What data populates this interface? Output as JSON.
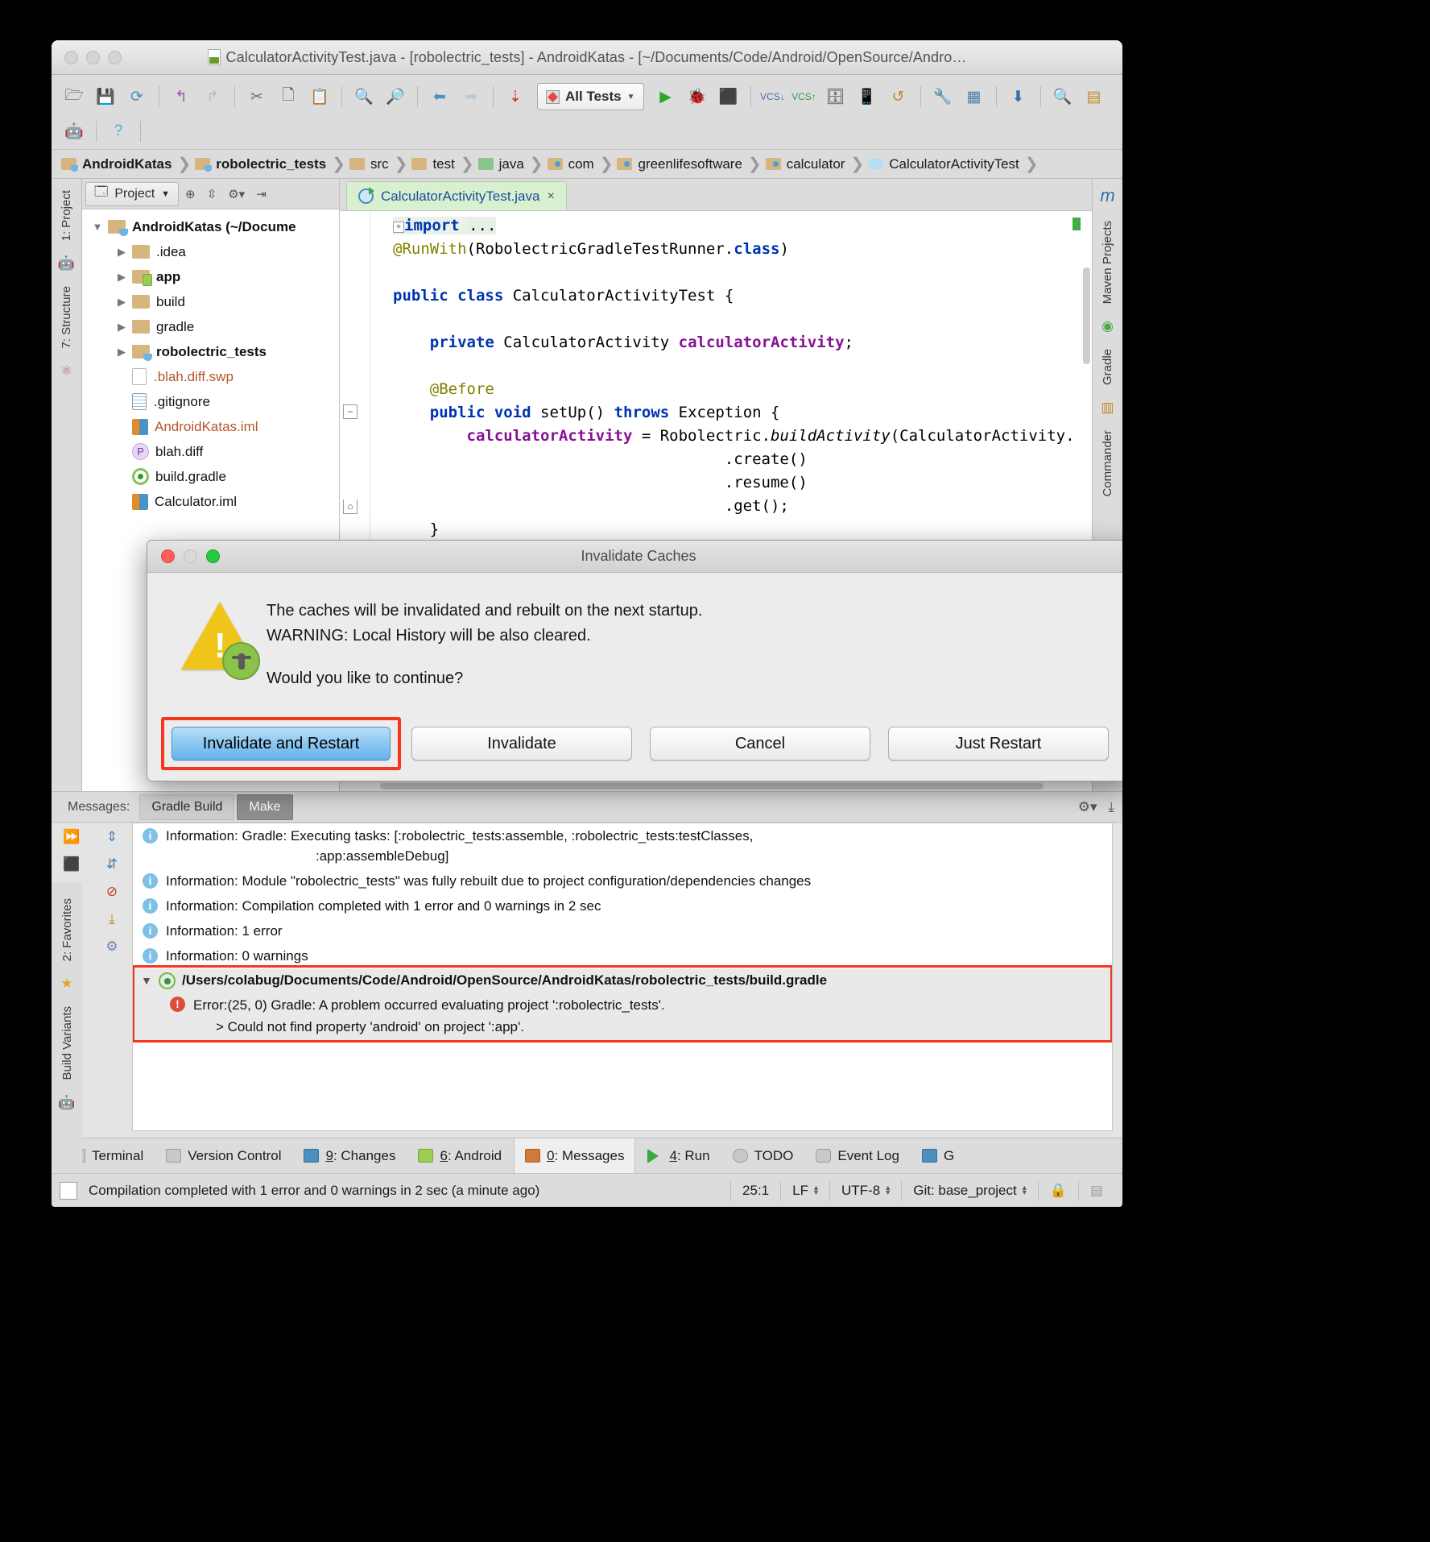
{
  "window": {
    "title": "CalculatorActivityTest.java - [robolectric_tests] - AndroidKatas - [~/Documents/Code/Android/OpenSource/Andro…",
    "title_icon": "java-file-icon"
  },
  "toolbar": {
    "run_config": "All Tests",
    "icons": [
      "open-folder-icon",
      "save-icon",
      "sync-icon",
      "undo-icon",
      "redo-icon",
      "cut-icon",
      "copy-icon",
      "paste-icon",
      "find-icon",
      "replace-icon",
      "back-icon",
      "forward-icon",
      "sort-icon",
      "run-icon",
      "debug-icon",
      "attach-debugger-icon",
      "vcs-update-icon",
      "vcs-commit-icon",
      "sdk-manager-icon",
      "avd-manager-icon",
      "rerun-icon",
      "search-everywhere-icon",
      "project-structure-icon",
      "download-icon",
      "inspect-icon",
      "android-icon",
      "help-icon"
    ]
  },
  "breadcrumbs": [
    {
      "label": "AndroidKatas",
      "icon": "folder-module-icon",
      "bold": true,
      "style": "cup"
    },
    {
      "label": "robolectric_tests",
      "icon": "folder-module-icon",
      "bold": true,
      "style": "cup"
    },
    {
      "label": "src",
      "icon": "folder-icon",
      "bold": false,
      "style": "plain"
    },
    {
      "label": "test",
      "icon": "folder-icon",
      "bold": false,
      "style": "plain"
    },
    {
      "label": "java",
      "icon": "folder-source-icon",
      "bold": false,
      "style": "green"
    },
    {
      "label": "com",
      "icon": "folder-package-icon",
      "bold": false,
      "style": "dot"
    },
    {
      "label": "greenlifesoftware",
      "icon": "folder-package-icon",
      "bold": false,
      "style": "dot"
    },
    {
      "label": "calculator",
      "icon": "folder-package-icon",
      "bold": false,
      "style": "dot"
    },
    {
      "label": "CalculatorActivityTest",
      "icon": "class-icon",
      "bold": false,
      "style": "class"
    }
  ],
  "left_rail": {
    "items": [
      "1: Project",
      "7: Structure"
    ],
    "bottom_items": [
      "2: Favorites",
      "Build Variants"
    ]
  },
  "right_rail": {
    "items": [
      "Maven Projects",
      "Gradle",
      "Commander"
    ],
    "logo": "m"
  },
  "project_panel": {
    "tab_label": "Project",
    "header_icons": [
      "target-icon",
      "collapse-all-icon",
      "gear-icon",
      "hide-icon",
      "chevron-down-icon"
    ],
    "tree": [
      {
        "label": "AndroidKatas (~/Docume",
        "icon": "folder-module-icon",
        "indent": 0,
        "arrow": "down",
        "bold": true,
        "color": "black"
      },
      {
        "label": ".idea",
        "icon": "folder-icon",
        "indent": 1,
        "arrow": "right",
        "bold": false,
        "color": "black"
      },
      {
        "label": "app",
        "icon": "folder-app-icon",
        "indent": 1,
        "arrow": "right",
        "bold": true,
        "color": "black"
      },
      {
        "label": "build",
        "icon": "folder-icon",
        "indent": 1,
        "arrow": "right",
        "bold": false,
        "color": "black"
      },
      {
        "label": "gradle",
        "icon": "folder-icon",
        "indent": 1,
        "arrow": "right",
        "bold": false,
        "color": "black"
      },
      {
        "label": "robolectric_tests",
        "icon": "folder-module-icon",
        "indent": 1,
        "arrow": "right",
        "bold": true,
        "color": "black"
      },
      {
        "label": ".blah.diff.swp",
        "icon": "file-blank-icon",
        "indent": 2,
        "arrow": "",
        "bold": false,
        "color": "red"
      },
      {
        "label": ".gitignore",
        "icon": "file-text-icon",
        "indent": 2,
        "arrow": "",
        "bold": false,
        "color": "black"
      },
      {
        "label": "AndroidKatas.iml",
        "icon": "iml-file-icon",
        "indent": 2,
        "arrow": "",
        "bold": false,
        "color": "red"
      },
      {
        "label": "blah.diff",
        "icon": "patch-file-icon",
        "indent": 2,
        "arrow": "",
        "bold": false,
        "color": "black"
      },
      {
        "label": "build.gradle",
        "icon": "gradle-file-icon",
        "indent": 2,
        "arrow": "",
        "bold": false,
        "color": "black"
      },
      {
        "label": "Calculator.iml",
        "icon": "iml-file-icon",
        "indent": 2,
        "arrow": "",
        "bold": false,
        "color": "black"
      }
    ]
  },
  "editor": {
    "tab": {
      "label": "CalculatorActivityTest.java",
      "icon": "java-class-icon",
      "close": "×"
    },
    "lines": [
      "import ...",
      "",
      "@RunWith(RobolectricGradleTestRunner.class)",
      "",
      "public class CalculatorActivityTest {",
      "",
      "    private CalculatorActivity calculatorActivity;",
      "",
      "    @Before",
      "    public void setUp() throws Exception {",
      "        calculatorActivity = Robolectric.buildActivity(CalculatorActivity.",
      "                                    .create()",
      "                                    .resume()",
      "                                    .get();",
      "    }"
    ]
  },
  "dialog": {
    "title": "Invalidate Caches",
    "icon": "warning-android-icon",
    "line1": "The caches will be invalidated and rebuilt on the next startup.",
    "line2": "WARNING: Local History will be also cleared.",
    "line3": "Would you like to continue?",
    "buttons": [
      {
        "label": "Invalidate and Restart",
        "default": true,
        "highlighted": true
      },
      {
        "label": "Invalidate",
        "default": false,
        "highlighted": false
      },
      {
        "label": "Cancel",
        "default": false,
        "highlighted": false
      },
      {
        "label": "Just Restart",
        "default": false,
        "highlighted": false
      }
    ]
  },
  "messages": {
    "label": "Messages:",
    "tabs": [
      {
        "label": "Gradle Build",
        "active": false
      },
      {
        "label": "Make",
        "active": true
      }
    ],
    "toolbar_icons": [
      "gear-icon",
      "export-icon"
    ],
    "side_icons": [
      "run-all-icon",
      "expand-all-icon",
      "stop-icon",
      "collapse-all-icon",
      "close-icon",
      "hide-warnings-icon",
      "up-icon",
      "export-icon",
      "down-icon",
      "settings-icon",
      "new-window-icon",
      "help-icon"
    ],
    "rows": [
      {
        "type": "info",
        "text": "Information: Gradle: Executing tasks: [:robolectric_tests:assemble, :robolectric_tests:testClasses,",
        "text2": ":app:assembleDebug]"
      },
      {
        "type": "info",
        "text": "Information: Module \"robolectric_tests\" was fully rebuilt due to project configuration/dependencies changes",
        "text2": ""
      },
      {
        "type": "info",
        "text": "Information: Compilation completed with 1 error and 0 warnings in 2 sec",
        "text2": ""
      },
      {
        "type": "info",
        "text": "Information: 1 error",
        "text2": ""
      },
      {
        "type": "info",
        "text": "Information: 0 warnings",
        "text2": ""
      }
    ],
    "error_group": {
      "path": "/Users/colabug/Documents/Code/Android/OpenSource/AndroidKatas/robolectric_tests/build.gradle",
      "icon": "gradle-file-icon",
      "arrow": "▼",
      "error_line1": "Error:(25, 0)  Gradle: A problem occurred evaluating project ':robolectric_tests'.",
      "error_line2": "> Could not find property 'android' on project ':app'."
    }
  },
  "bottom_tabs": [
    {
      "label": "Terminal",
      "icon": "terminal-icon",
      "num": "",
      "active": false
    },
    {
      "label": "Version Control",
      "icon": "vcs-icon",
      "num": "",
      "active": false
    },
    {
      "label": "Changes",
      "icon": "changes-icon",
      "num": "9",
      "active": false
    },
    {
      "label": "Android",
      "icon": "android-icon",
      "num": "6",
      "active": false
    },
    {
      "label": "Messages",
      "icon": "messages-icon",
      "num": "0",
      "active": true
    },
    {
      "label": "Run",
      "icon": "run-icon",
      "num": "4",
      "active": false
    },
    {
      "label": "TODO",
      "icon": "todo-icon",
      "num": "",
      "active": false
    },
    {
      "label": "Event Log",
      "icon": "event-log-icon",
      "num": "",
      "active": false
    },
    {
      "label": "G",
      "icon": "gradle-icon",
      "num": "",
      "active": false
    }
  ],
  "status_bar": {
    "message": "Compilation completed with 1 error and 0 warnings in 2 sec (a minute ago)",
    "caret": "25:1",
    "line_sep": "LF",
    "encoding": "UTF-8",
    "branch": "Git: base_project",
    "icons": [
      "lock-icon",
      "inspector-icon"
    ]
  }
}
